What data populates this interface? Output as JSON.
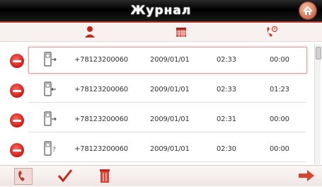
{
  "header": {
    "title": "Журнал"
  },
  "columns": {
    "contact_icon": "person-icon",
    "date_icon": "calendar-icon",
    "duration_icon": "phone-clock-icon"
  },
  "rows": [
    {
      "type_icon": "outgoing-call-icon",
      "number": "+78123200060",
      "date": "2009/01/01",
      "time": "02:33",
      "duration": "00:00",
      "selected": true
    },
    {
      "type_icon": "incoming-call-icon",
      "number": "+78123200060",
      "date": "2009/01/01",
      "time": "02:33",
      "duration": "01:23",
      "selected": false
    },
    {
      "type_icon": "outgoing-call-icon",
      "number": "+78123200060",
      "date": "2009/01/01",
      "time": "02:31",
      "duration": "00:00",
      "selected": false
    },
    {
      "type_icon": "missed-call-icon",
      "number": "+78123200060",
      "date": "2009/01/01",
      "time": "02:30",
      "duration": "00:00",
      "selected": false
    }
  ],
  "toolbar": {
    "icons": [
      "call-icon",
      "check-icon",
      "trash-icon",
      "next-arrow-icon"
    ]
  },
  "colors": {
    "accent": "#c81b15",
    "title_bar": "#000000"
  }
}
